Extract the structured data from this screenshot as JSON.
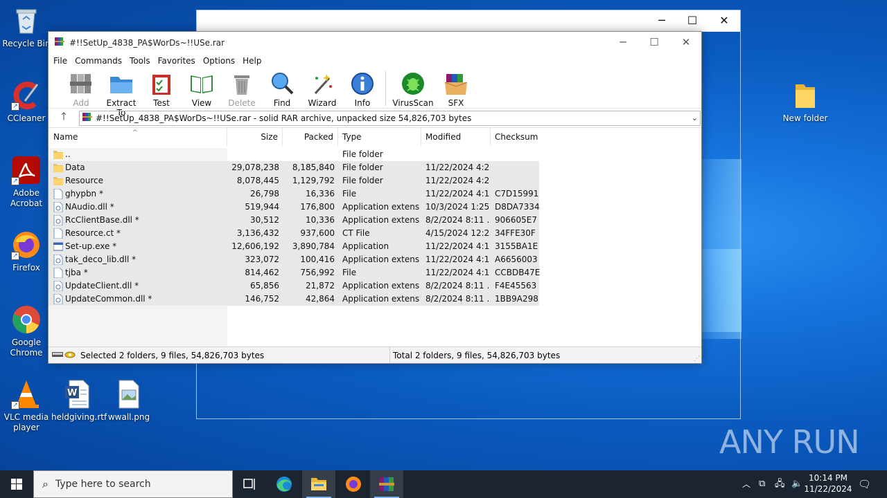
{
  "desktop": {
    "icons": [
      {
        "label": "Recycle Bin",
        "icon": "recycle-bin-icon"
      },
      {
        "label": "CCleaner",
        "icon": "ccleaner-icon"
      },
      {
        "label": "Adobe Acrobat",
        "icon": "adobe-acrobat-icon"
      },
      {
        "label": "Firefox",
        "icon": "firefox-icon"
      },
      {
        "label": "Google Chrome",
        "icon": "chrome-icon"
      },
      {
        "label": "VLC media player",
        "icon": "vlc-icon"
      },
      {
        "label": "heldgiving.rtf",
        "icon": "word-document-icon"
      },
      {
        "label": "wwall.png",
        "icon": "image-file-icon"
      },
      {
        "label": "New folder",
        "icon": "folder-icon"
      }
    ],
    "watermark": "ANY RUN"
  },
  "winrar": {
    "title": "#!!SetUp_4838_PA$WorDs~!!USe.rar",
    "menu": [
      "File",
      "Commands",
      "Tools",
      "Favorites",
      "Options",
      "Help"
    ],
    "toolbar": [
      {
        "label": "Add",
        "icon": "add-icon",
        "disabled": true
      },
      {
        "label": "Extract To",
        "icon": "extract-folder-icon"
      },
      {
        "label": "Test",
        "icon": "test-clipboard-icon"
      },
      {
        "label": "View",
        "icon": "view-book-icon"
      },
      {
        "label": "Delete",
        "icon": "delete-trash-icon",
        "disabled": true
      },
      {
        "label": "Find",
        "icon": "find-magnifier-icon"
      },
      {
        "label": "Wizard",
        "icon": "wizard-wand-icon"
      },
      {
        "label": "Info",
        "icon": "info-icon"
      },
      {
        "label": "VirusScan",
        "icon": "virusscan-bug-icon"
      },
      {
        "label": "SFX",
        "icon": "sfx-box-icon"
      }
    ],
    "address": "#!!SetUp_4838_PA$WorDs~!!USe.rar - solid RAR archive, unpacked size 54,826,703 bytes",
    "columns": [
      "Name",
      "Size",
      "Packed",
      "Type",
      "Modified",
      "Checksum"
    ],
    "rows": [
      {
        "name": "..",
        "size": "",
        "packed": "",
        "type": "File folder",
        "modified": "",
        "checksum": "",
        "kind": "folder"
      },
      {
        "name": "Data",
        "size": "29,078,238",
        "packed": "8,185,840",
        "type": "File folder",
        "modified": "11/22/2024 4:2...",
        "checksum": "",
        "kind": "folder"
      },
      {
        "name": "Resource",
        "size": "8,078,445",
        "packed": "1,129,792",
        "type": "File folder",
        "modified": "11/22/2024 4:2...",
        "checksum": "",
        "kind": "folder"
      },
      {
        "name": "ghypbn *",
        "size": "26,798",
        "packed": "16,336",
        "type": "File",
        "modified": "11/22/2024 4:1...",
        "checksum": "C7D15991",
        "kind": "file"
      },
      {
        "name": "NAudio.dll *",
        "size": "519,944",
        "packed": "176,800",
        "type": "Application extens...",
        "modified": "10/3/2024 1:25 ...",
        "checksum": "D8DA7334",
        "kind": "dll"
      },
      {
        "name": "RcClientBase.dll *",
        "size": "30,512",
        "packed": "10,336",
        "type": "Application extens...",
        "modified": "8/2/2024 8:11 ...",
        "checksum": "906605E7",
        "kind": "dll"
      },
      {
        "name": "Resource.ct *",
        "size": "3,136,432",
        "packed": "937,600",
        "type": "CT File",
        "modified": "4/15/2024 12:2...",
        "checksum": "34FFE30F",
        "kind": "file"
      },
      {
        "name": "Set-up.exe *",
        "size": "12,606,192",
        "packed": "3,890,784",
        "type": "Application",
        "modified": "11/22/2024 4:1...",
        "checksum": "3155BA1E",
        "kind": "exe"
      },
      {
        "name": "tak_deco_lib.dll *",
        "size": "323,072",
        "packed": "100,416",
        "type": "Application extens...",
        "modified": "11/22/2024 4:1...",
        "checksum": "A6656003",
        "kind": "dll"
      },
      {
        "name": "tjba *",
        "size": "814,462",
        "packed": "756,992",
        "type": "File",
        "modified": "11/22/2024 4:1...",
        "checksum": "CCBDB47E",
        "kind": "file"
      },
      {
        "name": "UpdateClient.dll *",
        "size": "65,856",
        "packed": "21,872",
        "type": "Application extens...",
        "modified": "8/2/2024 8:11 ...",
        "checksum": "F4E45563",
        "kind": "dll"
      },
      {
        "name": "UpdateCommon.dll *",
        "size": "146,752",
        "packed": "42,864",
        "type": "Application extens...",
        "modified": "8/2/2024 8:11 ...",
        "checksum": "1BB9A298",
        "kind": "dll"
      }
    ],
    "status_left": "Selected 2 folders, 9 files, 54,826,703 bytes",
    "status_right": "Total 2 folders, 9 files, 54,826,703 bytes"
  },
  "taskbar": {
    "search_placeholder": "Type here to search",
    "apps": [
      "task-view-icon",
      "edge-icon",
      "file-explorer-icon",
      "firefox-icon",
      "winrar-icon"
    ],
    "time": "10:14 PM",
    "date": "11/22/2024"
  },
  "colors": {
    "accent": "#0a5fc4",
    "taskbar": "#1b2430",
    "selection": "#e8e8e8"
  }
}
